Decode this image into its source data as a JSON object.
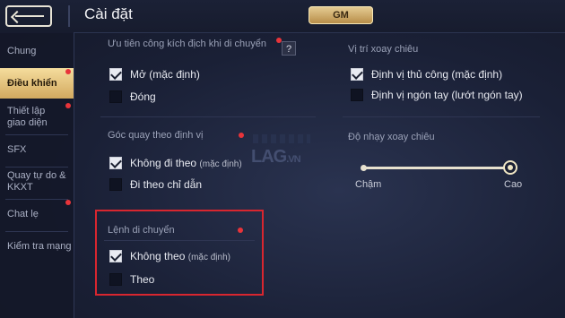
{
  "header": {
    "title": "Cài đặt",
    "gm_label": "GM"
  },
  "sidebar": {
    "items": [
      {
        "label": "Chung"
      },
      {
        "label": "Điều khiển"
      },
      {
        "label": "Thiết lập giao diện"
      },
      {
        "label": "SFX"
      },
      {
        "label": "Quay tự do & KKXT"
      },
      {
        "label": "Chat lẹ"
      },
      {
        "label": "Kiểm tra mạng"
      }
    ]
  },
  "attack_priority": {
    "label": "Ưu tiên công kích địch khi di chuyển",
    "help": "?",
    "options": [
      {
        "label": "Mở",
        "note": "(mặc định)",
        "checked": true
      },
      {
        "label": "Đóng",
        "note": "",
        "checked": false
      }
    ]
  },
  "camera": {
    "label": "Góc quay theo định vị",
    "options": [
      {
        "label": "Không đi theo",
        "note": "(mặc định)",
        "checked": true
      },
      {
        "label": "Đi theo chỉ dẫn",
        "note": "",
        "checked": false
      }
    ]
  },
  "move_command": {
    "label": "Lệnh di chuyển",
    "options": [
      {
        "label": "Không theo",
        "note": "(mặc định)",
        "checked": true
      },
      {
        "label": "Theo",
        "note": "",
        "checked": false
      }
    ]
  },
  "skill_position": {
    "label": "Vị trí xoay chiêu",
    "options": [
      {
        "label": "Định vị thủ công",
        "note": "(mặc định)",
        "checked": true
      },
      {
        "label": "Định vị ngón tay",
        "note": "(lướt ngón tay)",
        "checked": false
      }
    ]
  },
  "sensitivity": {
    "label": "Độ nhạy xoay chiêu",
    "min_label": "Chậm",
    "max_label": "Cao",
    "value_fraction": 1.0
  },
  "watermark": {
    "brand": "LAG",
    "suffix": ".VN"
  }
}
